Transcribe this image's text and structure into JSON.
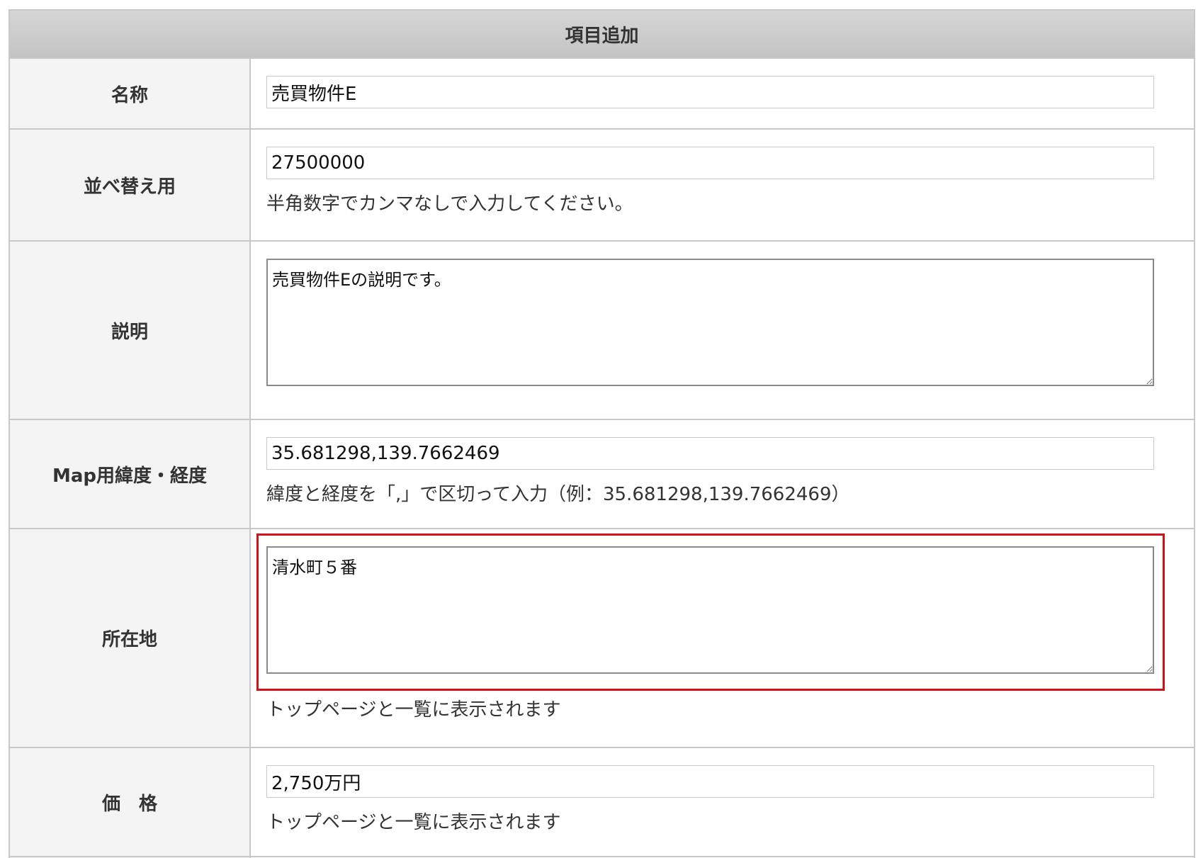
{
  "header": {
    "title": "項目追加"
  },
  "rows": {
    "name": {
      "label": "名称",
      "value": "売買物件E"
    },
    "sort": {
      "label": "並べ替え用",
      "value": "27500000",
      "hint": "半角数字でカンマなしで入力してください。"
    },
    "description": {
      "label": "説明",
      "value": "売買物件Eの説明です。"
    },
    "latlng": {
      "label": "Map用緯度・経度",
      "value": "35.681298,139.7662469",
      "hint": "緯度と経度を「,」で区切って入力（例：35.681298,139.7662469）"
    },
    "address": {
      "label": "所在地",
      "value": "清水町５番",
      "hint": "トップページと一覧に表示されます"
    },
    "price": {
      "label": "価　格",
      "value": "2,750万円",
      "hint": "トップページと一覧に表示されます"
    }
  },
  "colors": {
    "highlight": "#d0121b",
    "header_bg": "#c8c8c8",
    "label_bg": "#f4f4f4"
  },
  "icons": [
    "resize-grip-icon"
  ]
}
